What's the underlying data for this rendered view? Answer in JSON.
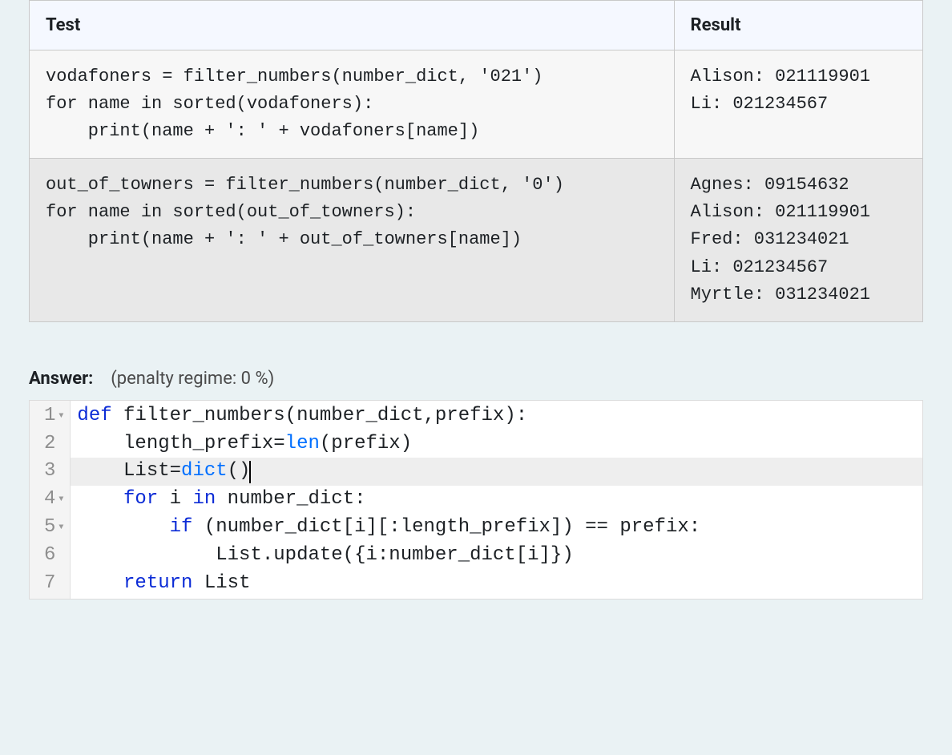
{
  "table": {
    "headers": {
      "test": "Test",
      "result": "Result"
    },
    "rows": [
      {
        "test": "vodafoners = filter_numbers(number_dict, '021')\nfor name in sorted(vodafoners):\n    print(name + ': ' + vodafoners[name])",
        "result": "Alison: 021119901\nLi: 021234567"
      },
      {
        "test": "out_of_towners = filter_numbers(number_dict, '0')\nfor name in sorted(out_of_towners):\n    print(name + ': ' + out_of_towners[name])",
        "result": "Agnes: 09154632\nAlison: 021119901\nFred: 031234021\nLi: 021234567\nMyrtle: 031234021"
      }
    ]
  },
  "answer": {
    "label": "Answer:",
    "regime": "(penalty regime: 0 %)"
  },
  "editor": {
    "active_line": 3,
    "lines": [
      {
        "n": "1",
        "fold": true,
        "tokens": [
          [
            "kw",
            "def"
          ],
          [
            "",
            " filter_numbers(number_dict,prefix):"
          ]
        ]
      },
      {
        "n": "2",
        "fold": false,
        "tokens": [
          [
            "",
            "    length_prefix="
          ],
          [
            "fn",
            "len"
          ],
          [
            "",
            "(prefix)"
          ]
        ]
      },
      {
        "n": "3",
        "fold": false,
        "tokens": [
          [
            "",
            "    List="
          ],
          [
            "fn",
            "dict"
          ],
          [
            "",
            "()"
          ]
        ],
        "cursor_after": true
      },
      {
        "n": "4",
        "fold": true,
        "tokens": [
          [
            "",
            "    "
          ],
          [
            "kw",
            "for"
          ],
          [
            "",
            " i "
          ],
          [
            "kw",
            "in"
          ],
          [
            "",
            " number_dict:"
          ]
        ]
      },
      {
        "n": "5",
        "fold": true,
        "tokens": [
          [
            "",
            "        "
          ],
          [
            "kw",
            "if"
          ],
          [
            "",
            " (number_dict[i][:length_prefix]) == prefix:"
          ]
        ]
      },
      {
        "n": "6",
        "fold": false,
        "tokens": [
          [
            "",
            "            List.update({i:number_dict[i]})"
          ]
        ]
      },
      {
        "n": "7",
        "fold": false,
        "tokens": [
          [
            "",
            "    "
          ],
          [
            "kw",
            "return"
          ],
          [
            "",
            " List"
          ]
        ]
      }
    ]
  }
}
